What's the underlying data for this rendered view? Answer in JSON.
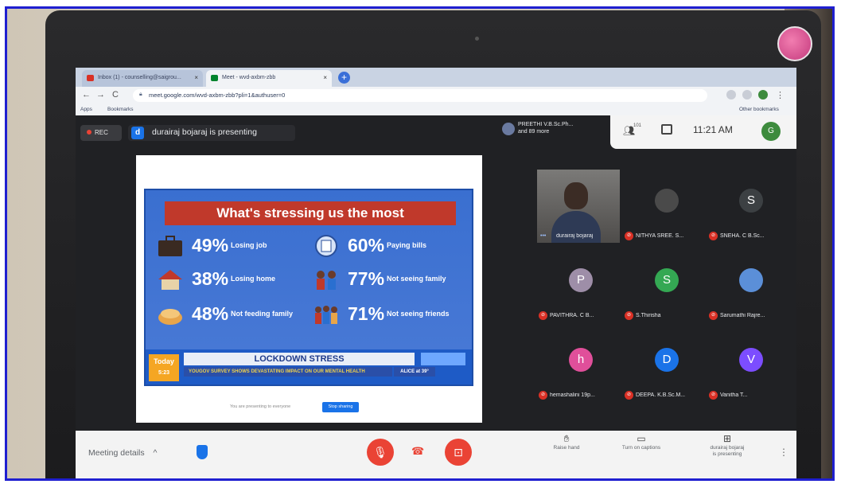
{
  "browser": {
    "tabs": [
      {
        "label": "Inbox (1) - counselling@saigrou..."
      },
      {
        "label": "Meet - wvd-axbm-zbb"
      }
    ],
    "new_tab": "+",
    "url": "meet.google.com/wvd-axbm-zbb?pli=1&authuser=0",
    "bookmarks": {
      "apps": "Apps",
      "bookmarks": "Bookmarks",
      "other": "Other bookmarks"
    }
  },
  "meet": {
    "rec_label": "REC",
    "presenter_initial": "d",
    "presenter_text": "durairaj bojaraj is presenting",
    "others_line1": "PREETHI V.B.Sc.Ph...",
    "others_line2": "and 89 more",
    "people_count": "101",
    "time": "11:21 AM",
    "self_initial": "G"
  },
  "slide": {
    "title": "What's stressing us the most",
    "stats": [
      {
        "pct": "49%",
        "label": "Losing job"
      },
      {
        "pct": "60%",
        "label": "Paying bills"
      },
      {
        "pct": "38%",
        "label": "Losing home"
      },
      {
        "pct": "77%",
        "label": "Not seeing family"
      },
      {
        "pct": "48%",
        "label": "Not feeding family"
      },
      {
        "pct": "71%",
        "label": "Not seeing friends"
      }
    ],
    "logo": "Today",
    "logo_time": "5:23",
    "banner_head": "LOCKDOWN STRESS",
    "banner_sub": "YOUGOV SURVEY SHOWS DEVASTATING IMPACT ON OUR MENTAL HEALTH",
    "banner_tag": "ALICE at 39°",
    "stop_text": "You are presenting to everyone",
    "stop_button": "Stop sharing"
  },
  "participants": [
    {
      "name": "durairaj bojaraj",
      "initial": "",
      "color": "#5a5a5a"
    },
    {
      "name": "NITHYA SREE. S...",
      "initial": "",
      "color": "#4a4a4a"
    },
    {
      "name": "SNEHA. C B.Sc...",
      "initial": "S",
      "color": "#3c4043"
    },
    {
      "name": "PAVITHRA. C B...",
      "initial": "P",
      "color": "#9e8ea8"
    },
    {
      "name": "S.Thirisha",
      "initial": "S",
      "color": "#34a853"
    },
    {
      "name": "Sarumathi Rajre...",
      "initial": "",
      "color": "#5b8fd8"
    },
    {
      "name": "hemashalini 19p...",
      "initial": "h",
      "color": "#e04f9a"
    },
    {
      "name": "DEEPA. K.B.Sc.M...",
      "initial": "D",
      "color": "#1a73e8"
    },
    {
      "name": "Vanitha T...",
      "initial": "V",
      "color": "#7c4dff"
    }
  ],
  "bottom": {
    "meeting_details": "Meeting details",
    "caret": "^",
    "raise_hand": "Raise hand",
    "captions": "Turn on captions",
    "presenting_line1": "durairaj bojaraj",
    "presenting_line2": "is presenting"
  }
}
